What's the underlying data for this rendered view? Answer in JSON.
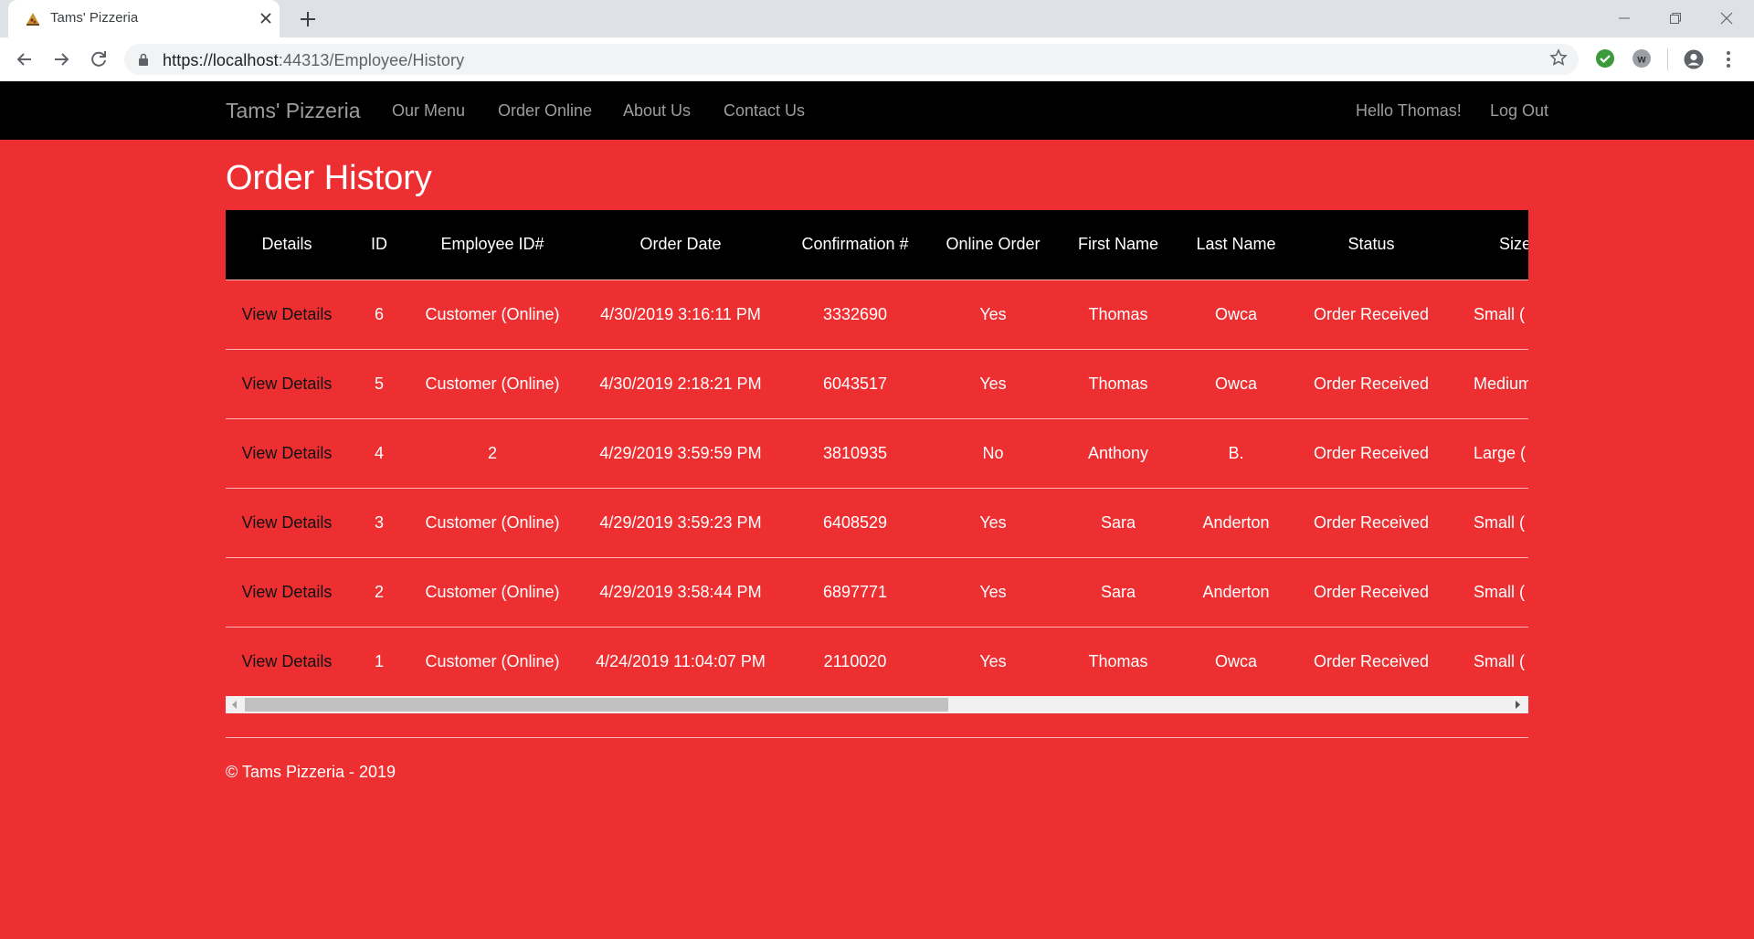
{
  "browser": {
    "tab_title": "Tams' Pizzeria",
    "url_host": "https://localhost",
    "url_path": ":44313/Employee/History"
  },
  "site": {
    "brand": "Tams' Pizzeria",
    "nav": [
      "Our Menu",
      "Order Online",
      "About Us",
      "Contact Us"
    ],
    "greeting": "Hello Thomas!",
    "logout": "Log Out"
  },
  "page": {
    "title": "Order History"
  },
  "table": {
    "headers": [
      "Details",
      "ID",
      "Employee ID#",
      "Order Date",
      "Confirmation #",
      "Online Order",
      "First Name",
      "Last Name",
      "Status",
      "Size"
    ],
    "rows": [
      [
        "View Details",
        "6",
        "Customer (Online)",
        "4/30/2019 3:16:11 PM",
        "3332690",
        "Yes",
        "Thomas",
        "Owca",
        "Order Received",
        "Small ("
      ],
      [
        "View Details",
        "5",
        "Customer (Online)",
        "4/30/2019 2:18:21 PM",
        "6043517",
        "Yes",
        "Thomas",
        "Owca",
        "Order Received",
        "Medium"
      ],
      [
        "View Details",
        "4",
        "2",
        "4/29/2019 3:59:59 PM",
        "3810935",
        "No",
        "Anthony",
        "B.",
        "Order Received",
        "Large ("
      ],
      [
        "View Details",
        "3",
        "Customer (Online)",
        "4/29/2019 3:59:23 PM",
        "6408529",
        "Yes",
        "Sara",
        "Anderton",
        "Order Received",
        "Small ("
      ],
      [
        "View Details",
        "2",
        "Customer (Online)",
        "4/29/2019 3:58:44 PM",
        "6897771",
        "Yes",
        "Sara",
        "Anderton",
        "Order Received",
        "Small ("
      ],
      [
        "View Details",
        "1",
        "Customer (Online)",
        "4/24/2019 11:04:07 PM",
        "2110020",
        "Yes",
        "Thomas",
        "Owca",
        "Order Received",
        "Small ("
      ]
    ]
  },
  "footer": {
    "text": "© Tams Pizzeria - 2019"
  },
  "colors": {
    "page_background": "#ee2f32",
    "navbar_background": "#000000",
    "nav_text": "#9d9d9d"
  },
  "icons": {
    "secure": "lock-icon",
    "bookmark": "star-icon",
    "extension_1": "check-circle-icon",
    "extension_2": "w-extension-icon",
    "profile": "account-circle-icon",
    "menu": "kebab-menu-icon"
  }
}
